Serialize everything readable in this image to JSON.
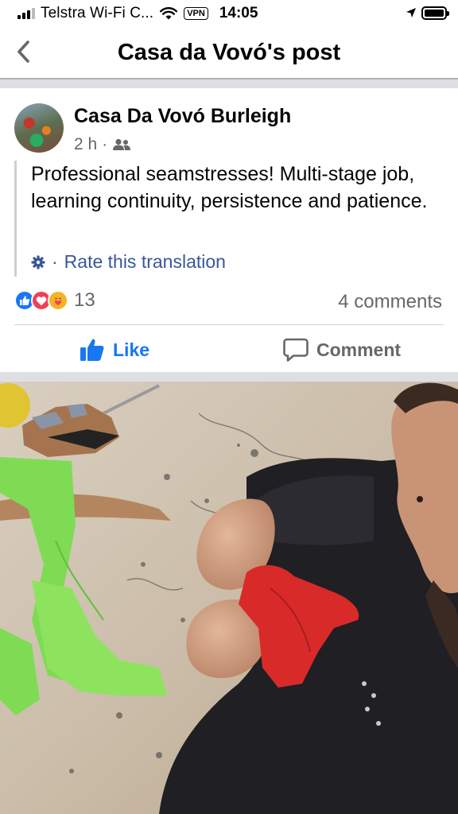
{
  "status_bar": {
    "carrier": "Telstra Wi-Fi C...",
    "vpn": "VPN",
    "time": "14:05"
  },
  "nav": {
    "title": "Casa da Vovó's post"
  },
  "post": {
    "author": "Casa Da Vovó Burleigh",
    "time": "2 h",
    "separator": "·",
    "text": "Professional seamstresses! Multi-stage job, learning continuity, persistence and patience.",
    "rate_separator": "·",
    "rate_label": "Rate this translation",
    "reaction_count": "13",
    "comments_label": "4 comments",
    "like_label": "Like",
    "comment_label": "Comment"
  },
  "colors": {
    "fb_blue": "#1877f2",
    "link_blue": "#385898",
    "meta_gray": "#65676b",
    "divider": "#dddfe2",
    "love_red": "#f33e58",
    "care_yellow": "#f7b125"
  }
}
